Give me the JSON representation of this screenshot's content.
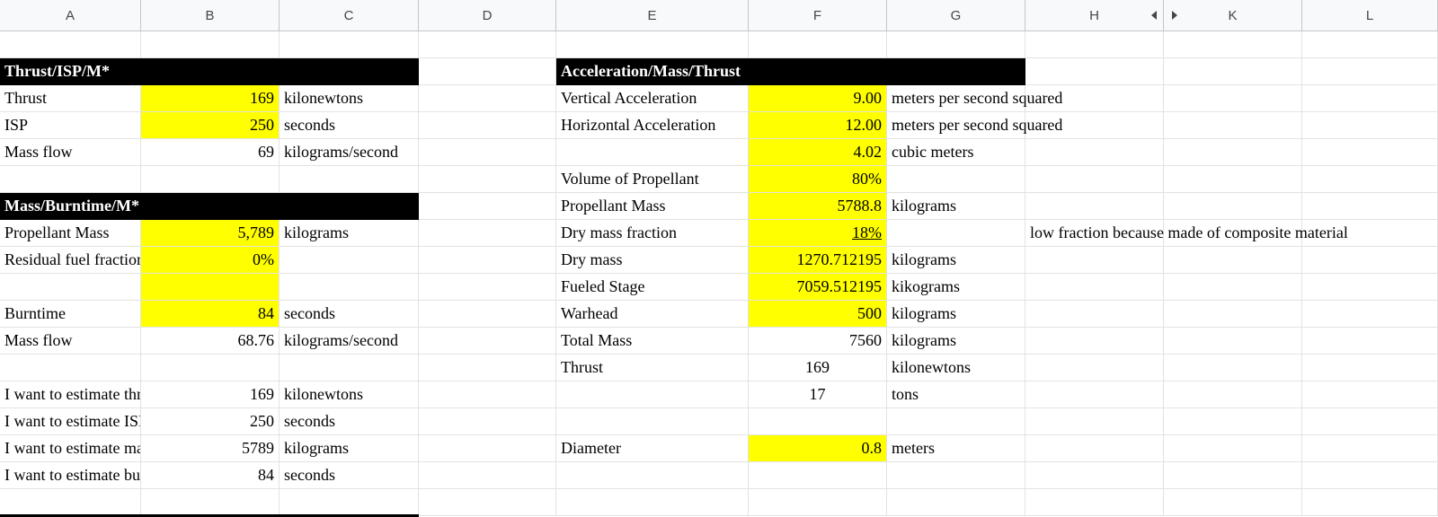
{
  "column_headers": [
    "A",
    "B",
    "C",
    "D",
    "E",
    "F",
    "G",
    "H",
    "K",
    "L"
  ],
  "cells": [
    {
      "col": "A",
      "row": 2,
      "text": "Thrust/ISP/M*",
      "style": "hdr",
      "span": 3
    },
    {
      "col": "E",
      "row": 2,
      "text": "Acceleration/Mass/Thrust",
      "style": "hdr",
      "span": 3
    },
    {
      "col": "A",
      "row": 3,
      "text": "Thrust"
    },
    {
      "col": "B",
      "row": 3,
      "text": "169",
      "align": "r",
      "style": "y"
    },
    {
      "col": "C",
      "row": 3,
      "text": "kilonewtons"
    },
    {
      "col": "E",
      "row": 3,
      "text": "Vertical Acceleration"
    },
    {
      "col": "F",
      "row": 3,
      "text": "9.00",
      "align": "r",
      "style": "y"
    },
    {
      "col": "G",
      "row": 3,
      "text": "meters per second squared",
      "overflow": true
    },
    {
      "col": "A",
      "row": 4,
      "text": "ISP"
    },
    {
      "col": "B",
      "row": 4,
      "text": "250",
      "align": "r",
      "style": "y"
    },
    {
      "col": "C",
      "row": 4,
      "text": "seconds"
    },
    {
      "col": "E",
      "row": 4,
      "text": "Horizontal Acceleration"
    },
    {
      "col": "F",
      "row": 4,
      "text": "12.00",
      "align": "r",
      "style": "y"
    },
    {
      "col": "G",
      "row": 4,
      "text": "meters per second squared",
      "overflow": true
    },
    {
      "col": "A",
      "row": 5,
      "text": "Mass flow"
    },
    {
      "col": "B",
      "row": 5,
      "text": "69",
      "align": "r"
    },
    {
      "col": "C",
      "row": 5,
      "text": "kilograms/second",
      "overflow": true
    },
    {
      "col": "F",
      "row": 5,
      "text": "4.02",
      "align": "r",
      "style": "y"
    },
    {
      "col": "G",
      "row": 5,
      "text": "cubic meters"
    },
    {
      "col": "E",
      "row": 6,
      "text": "Volume of Propellant"
    },
    {
      "col": "F",
      "row": 6,
      "text": "80%",
      "align": "r",
      "style": "y"
    },
    {
      "col": "A",
      "row": 7,
      "text": "Mass/Burntime/M*",
      "style": "hdr",
      "span": 3
    },
    {
      "col": "E",
      "row": 7,
      "text": "Propellant Mass"
    },
    {
      "col": "F",
      "row": 7,
      "text": "5788.8",
      "align": "r",
      "style": "y"
    },
    {
      "col": "G",
      "row": 7,
      "text": "kilograms"
    },
    {
      "col": "A",
      "row": 8,
      "text": "Propellant Mass"
    },
    {
      "col": "B",
      "row": 8,
      "text": "5,789",
      "align": "r",
      "style": "y"
    },
    {
      "col": "C",
      "row": 8,
      "text": "kilograms"
    },
    {
      "col": "E",
      "row": 8,
      "text": "Dry mass fraction"
    },
    {
      "col": "F",
      "row": 8,
      "text": "18%",
      "align": "r",
      "style": "y",
      "underline": true
    },
    {
      "col": "H",
      "row": 8,
      "text": "low fraction because made of composite material",
      "overflow": true
    },
    {
      "col": "A",
      "row": 9,
      "text": "Residual fuel fraction"
    },
    {
      "col": "B",
      "row": 9,
      "text": "0%",
      "align": "r",
      "style": "y"
    },
    {
      "col": "E",
      "row": 9,
      "text": "Dry mass"
    },
    {
      "col": "F",
      "row": 9,
      "text": "1270.712195",
      "align": "r",
      "style": "y"
    },
    {
      "col": "G",
      "row": 9,
      "text": "kilograms"
    },
    {
      "col": "B",
      "row": 10,
      "text": "",
      "style": "y"
    },
    {
      "col": "E",
      "row": 10,
      "text": "Fueled Stage"
    },
    {
      "col": "F",
      "row": 10,
      "text": "7059.512195",
      "align": "r",
      "style": "y"
    },
    {
      "col": "G",
      "row": 10,
      "text": "kikograms"
    },
    {
      "col": "A",
      "row": 11,
      "text": "Burntime"
    },
    {
      "col": "B",
      "row": 11,
      "text": "84",
      "align": "r",
      "style": "y"
    },
    {
      "col": "C",
      "row": 11,
      "text": "seconds"
    },
    {
      "col": "E",
      "row": 11,
      "text": "Warhead"
    },
    {
      "col": "F",
      "row": 11,
      "text": "500",
      "align": "r",
      "style": "y"
    },
    {
      "col": "G",
      "row": 11,
      "text": "kilograms"
    },
    {
      "col": "A",
      "row": 12,
      "text": "Mass flow"
    },
    {
      "col": "B",
      "row": 12,
      "text": "68.76",
      "align": "r"
    },
    {
      "col": "C",
      "row": 12,
      "text": "kilograms/second",
      "overflow": true
    },
    {
      "col": "E",
      "row": 12,
      "text": "Total Mass"
    },
    {
      "col": "F",
      "row": 12,
      "text": "7560",
      "align": "r"
    },
    {
      "col": "G",
      "row": 12,
      "text": "kilograms"
    },
    {
      "col": "E",
      "row": 13,
      "text": "Thrust"
    },
    {
      "col": "F",
      "row": 13,
      "text": "169",
      "align": "c"
    },
    {
      "col": "G",
      "row": 13,
      "text": "kilonewtons"
    },
    {
      "col": "A",
      "row": 14,
      "text": "I want to estimate thrust"
    },
    {
      "col": "B",
      "row": 14,
      "text": "169",
      "align": "r"
    },
    {
      "col": "C",
      "row": 14,
      "text": "kilonewtons"
    },
    {
      "col": "F",
      "row": 14,
      "text": "17",
      "align": "c"
    },
    {
      "col": "G",
      "row": 14,
      "text": "tons"
    },
    {
      "col": "A",
      "row": 15,
      "text": "I want to estimate ISP"
    },
    {
      "col": "B",
      "row": 15,
      "text": "250",
      "align": "r"
    },
    {
      "col": "C",
      "row": 15,
      "text": "seconds"
    },
    {
      "col": "A",
      "row": 16,
      "text": "I want to estimate mass"
    },
    {
      "col": "B",
      "row": 16,
      "text": "5789",
      "align": "r"
    },
    {
      "col": "C",
      "row": 16,
      "text": "kilograms"
    },
    {
      "col": "E",
      "row": 16,
      "text": "Diameter"
    },
    {
      "col": "F",
      "row": 16,
      "text": "0.8",
      "align": "r",
      "style": "y"
    },
    {
      "col": "G",
      "row": 16,
      "text": "meters"
    },
    {
      "col": "A",
      "row": 17,
      "text": "I want to estimate burntime"
    },
    {
      "col": "B",
      "row": 17,
      "text": "84",
      "align": "r"
    },
    {
      "col": "C",
      "row": 17,
      "text": "seconds"
    }
  ]
}
